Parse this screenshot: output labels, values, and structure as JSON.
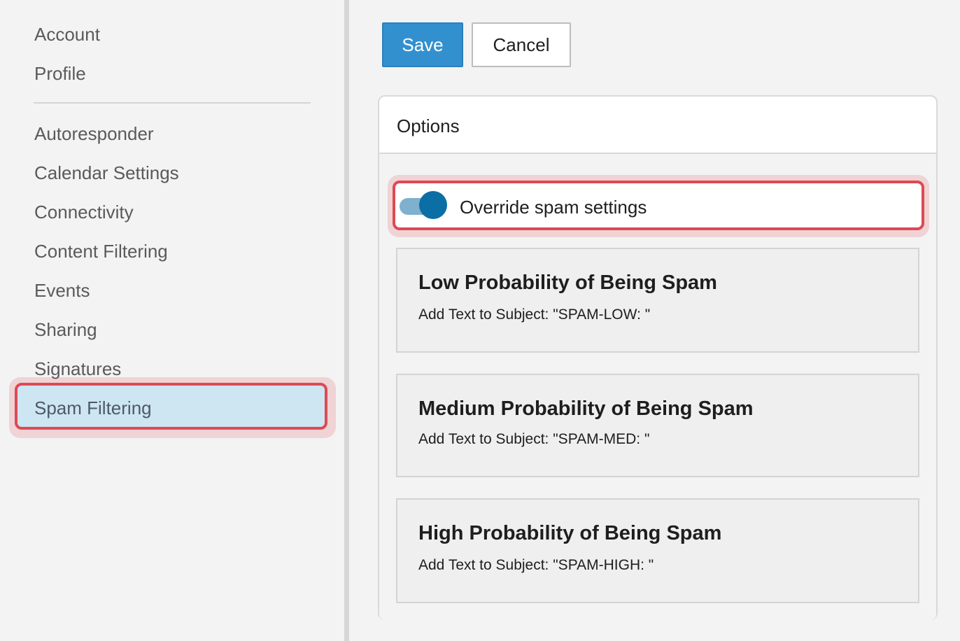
{
  "sidebar": {
    "group1": [
      "Account",
      "Profile"
    ],
    "group2": [
      "Autoresponder",
      "Calendar Settings",
      "Connectivity",
      "Content Filtering",
      "Events",
      "Sharing",
      "Signatures"
    ],
    "active_item": "Spam Filtering"
  },
  "toolbar": {
    "save_label": "Save",
    "cancel_label": "Cancel"
  },
  "options": {
    "title": "Options",
    "override_label": "Override spam settings",
    "override_enabled": true,
    "cards": [
      {
        "title": "Low Probability of Being Spam",
        "subtitle": "Add Text to Subject: \"SPAM-LOW: \""
      },
      {
        "title": "Medium Probability of Being Spam",
        "subtitle": "Add Text to Subject: \"SPAM-MED: \""
      },
      {
        "title": "High Probability of Being Spam",
        "subtitle": "Add Text to Subject: \"SPAM-HIGH: \""
      }
    ]
  },
  "colors": {
    "primary": "#3390cf",
    "highlight_border": "#dc4a55",
    "active_bg": "#cee5f2",
    "switch_knob": "#0b6ea4",
    "switch_track": "#7fb0ce"
  }
}
